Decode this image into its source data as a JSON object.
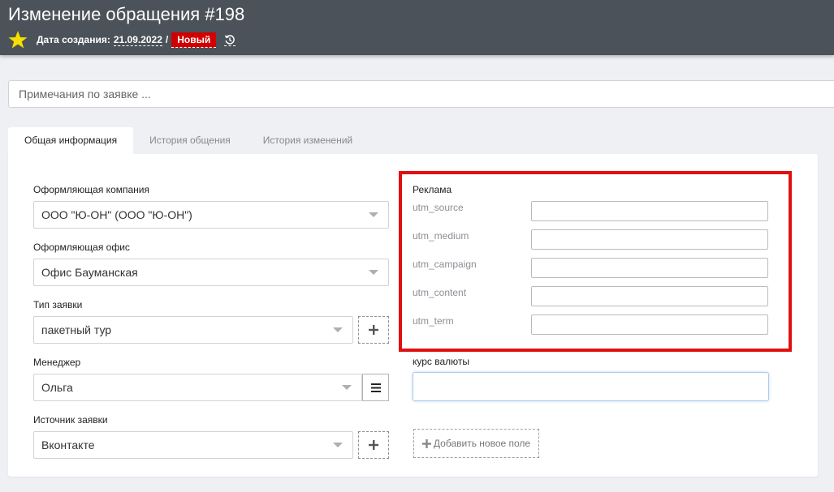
{
  "header": {
    "title": "Изменение обращения #198",
    "created_label": "Дата создания:",
    "created_date": "21.09.2022",
    "separator": "/",
    "status": "Новый"
  },
  "notes": {
    "placeholder": "Примечания по заявке ..."
  },
  "tabs": [
    {
      "label": "Общая информация"
    },
    {
      "label": "История общения"
    },
    {
      "label": "История изменений"
    }
  ],
  "form": {
    "company": {
      "label": "Оформляющая компания",
      "value": "ООО \"Ю-ОН\" (ООО \"Ю-ОН\")"
    },
    "office": {
      "label": "Оформляющая офис",
      "value": "Офис Бауманская"
    },
    "request_type": {
      "label": "Тип заявки",
      "value": "пакетный тур"
    },
    "manager": {
      "label": "Менеджер",
      "value": "Ольга"
    },
    "source": {
      "label": "Источник заявки",
      "value": "Вконтакте"
    }
  },
  "ads": {
    "title": "Реклама",
    "fields": [
      {
        "label": "utm_source",
        "value": ""
      },
      {
        "label": "utm_medium",
        "value": ""
      },
      {
        "label": "utm_campaign",
        "value": ""
      },
      {
        "label": "utm_content",
        "value": ""
      },
      {
        "label": "utm_term",
        "value": ""
      }
    ]
  },
  "currency_rate": {
    "label": "курс валюты",
    "value": ""
  },
  "add_field_label": "Добавить новое поле",
  "colors": {
    "topbar": "#4b5259",
    "badge": "#d10000",
    "star": "#f5e000",
    "highlight": "#e01010"
  },
  "icons": [
    "star-icon",
    "history-icon",
    "chevron-down-icon",
    "plus-icon",
    "list-icon"
  ]
}
